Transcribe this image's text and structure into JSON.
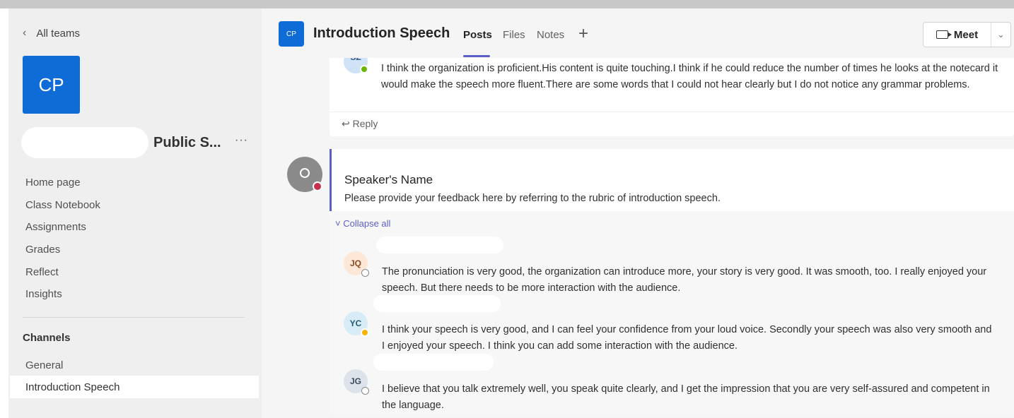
{
  "sidebar": {
    "back_label": "All teams",
    "team_initials": "CP",
    "team_name": "Public S...",
    "more_label": "···",
    "nav_items": [
      "Home page",
      "Class Notebook",
      "Assignments",
      "Grades",
      "Reflect",
      "Insights"
    ],
    "channels_heading": "Channels",
    "channels": [
      "General",
      "Introduction Speech"
    ]
  },
  "header": {
    "channel_initials": "CP",
    "channel_title": "Introduction Speech",
    "tabs": [
      "Posts",
      "Files",
      "Notes"
    ],
    "add_tab_label": "+",
    "meet_label": "Meet"
  },
  "top_message": {
    "author_initials": "SZ",
    "text": "I think the organization is proficient.His content is quite touching.I think if he could reduce the number of times he looks at the notecard it would make the speech more fluent.There are some words that I could not hear clearly but I do not notice any grammar problems.",
    "reply_label": "Reply"
  },
  "post": {
    "title": "Speaker's Name",
    "body": "Please provide your feedback here by referring to the rubric of introduction speech.",
    "collapse_label": "Collapse all",
    "replies": [
      {
        "initials": "JQ",
        "text": "The pronunciation is very good, the organization can introduce more, your story is very good. It was smooth, too. I really enjoyed your speech. But there needs to be more interaction with the audience."
      },
      {
        "initials": "YC",
        "text": "I think your speech is very good, and I can feel your confidence from your loud voice. Secondly your speech was also very smooth and I enjoyed your speech. I think you can add some interaction with the audience."
      },
      {
        "initials": "JG",
        "text": "I believe that you talk extremely well, you speak quite clearly, and I get the impression that you are very self-assured and competent in the language."
      }
    ]
  },
  "colors": {
    "accent": "#5b5fc7",
    "team_blue": "#0f6cd6",
    "presence_available": "#6bb700",
    "presence_busy": "#c4314b",
    "presence_away": "#f8b301"
  }
}
